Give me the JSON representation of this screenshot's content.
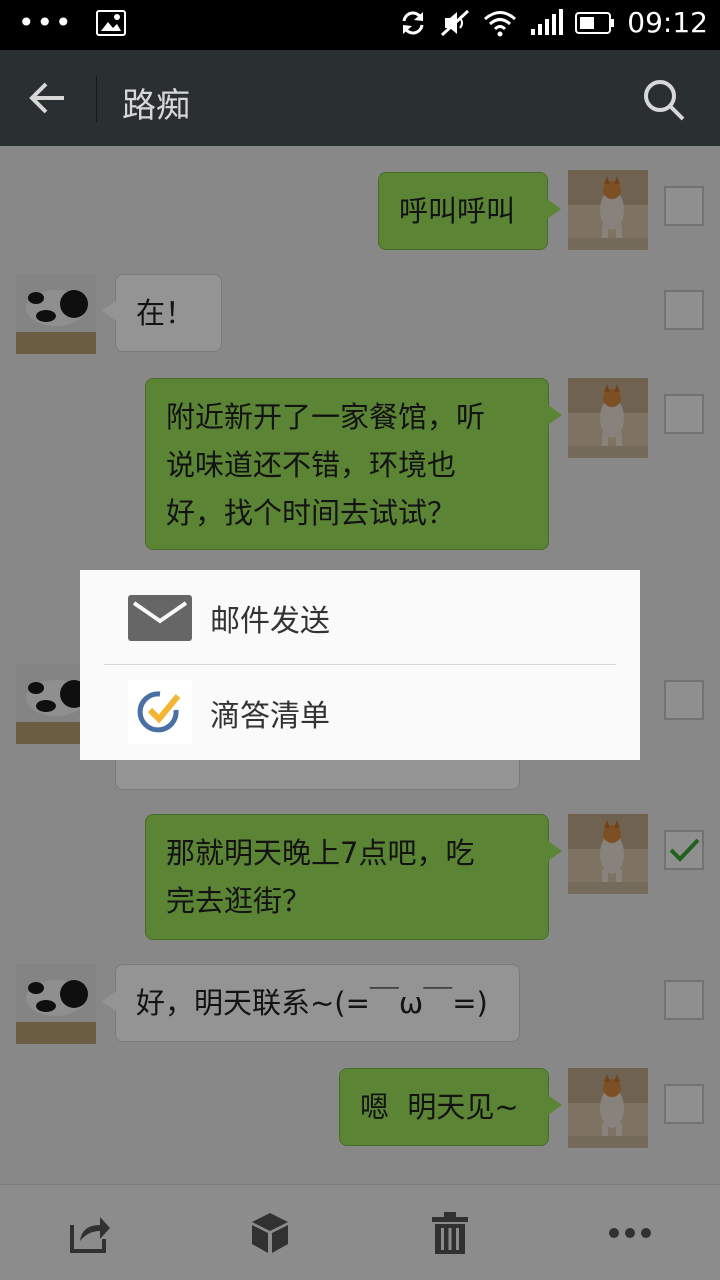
{
  "status_bar": {
    "time": "09:12",
    "more_icon": "more-dots-icon",
    "icons": [
      "sync-icon",
      "mute-icon",
      "wifi-icon",
      "signal-icon",
      "battery-icon"
    ]
  },
  "header": {
    "title": "路痴",
    "back_icon": "back-arrow-icon",
    "search_icon": "search-icon"
  },
  "messages": [
    {
      "direction": "out",
      "text": "呼叫呼叫",
      "checked": false
    },
    {
      "direction": "in",
      "text": "在！",
      "checked": false
    },
    {
      "direction": "out",
      "lines": [
        "附近新开了一家餐馆，听",
        "说味道还不错，环境也",
        "好，找个时间去试试？"
      ],
      "checked": false
    },
    {
      "direction": "in",
      "text": "",
      "checked": false
    },
    {
      "direction": "out",
      "lines": [
        "那就明天晚上7点吧，吃",
        "完去逛街？"
      ],
      "checked": true
    },
    {
      "direction": "in",
      "text": "好，明天联系~(=￣ω￣=)",
      "checked": false
    },
    {
      "direction": "out",
      "text": "嗯  明天见~",
      "checked": false
    }
  ],
  "share_menu": {
    "items": [
      {
        "label": "邮件发送",
        "icon": "mail-icon"
      },
      {
        "label": "滴答清单",
        "icon": "ticktick-icon"
      }
    ]
  },
  "bottom_bar": {
    "icons": [
      "share-icon",
      "box-icon",
      "trash-icon",
      "more-icon"
    ]
  },
  "colors": {
    "accent_green": "#9de45a",
    "check_green": "#3aa832",
    "header_bg": "#2a2f32"
  }
}
